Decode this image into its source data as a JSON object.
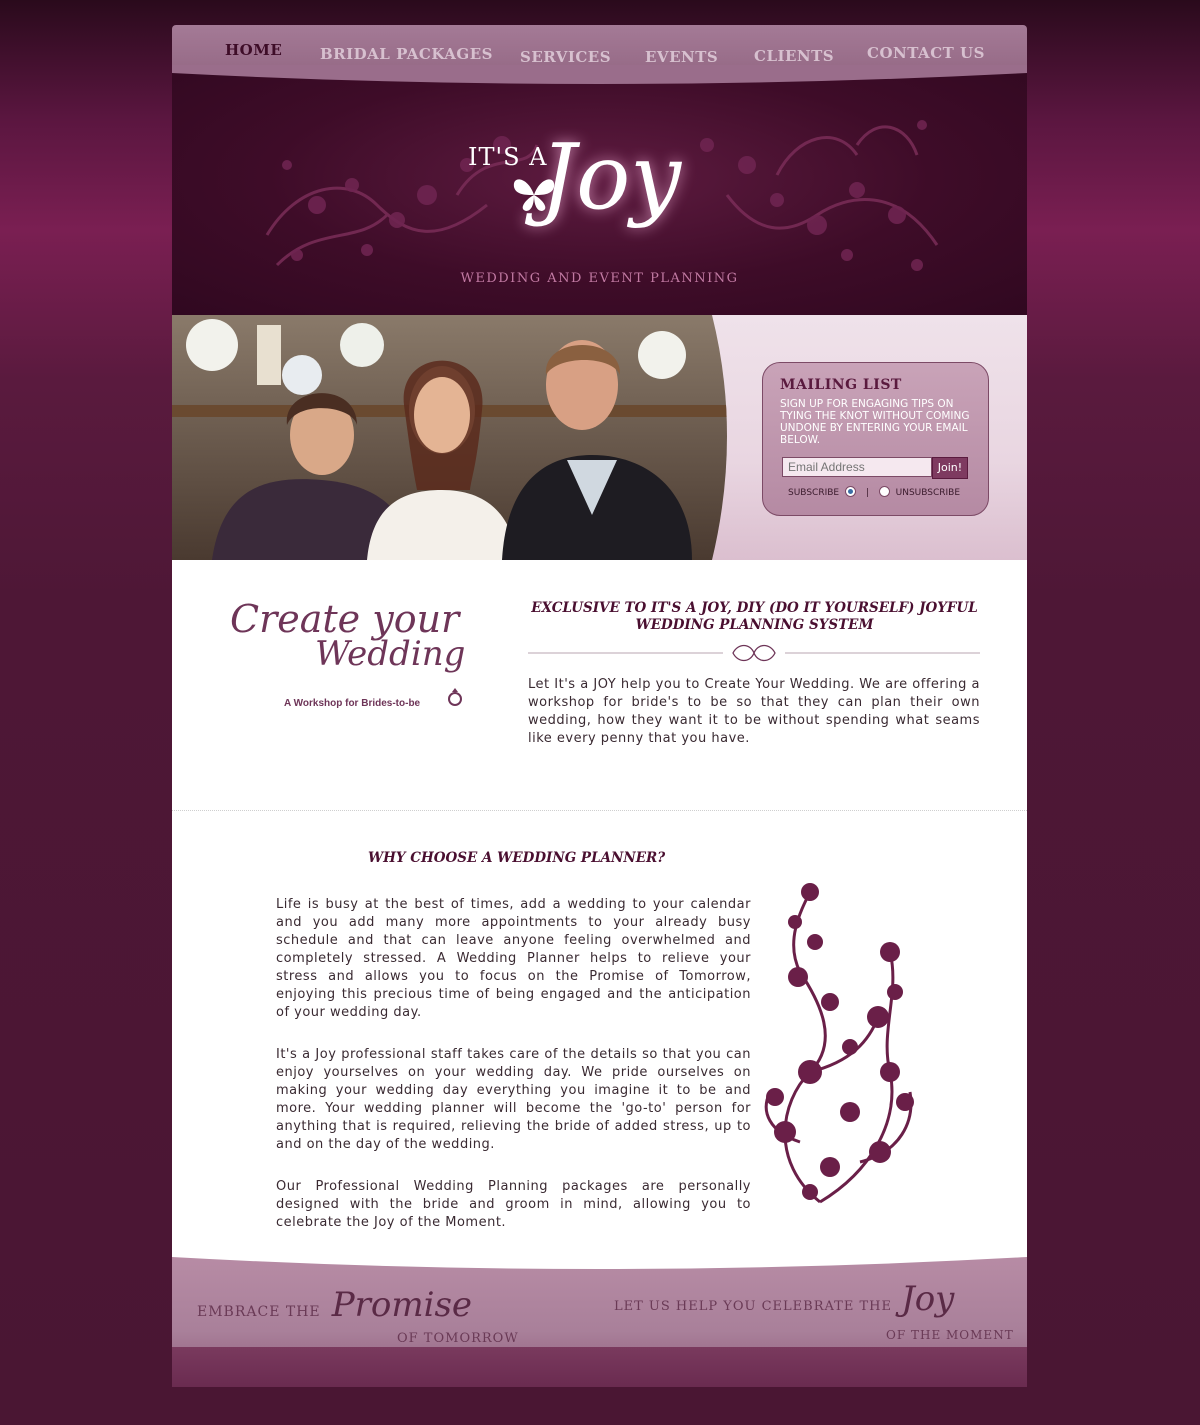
{
  "nav": {
    "items": [
      "HOME",
      "BRIDAL PACKAGES",
      "SERVICES",
      "EVENTS",
      "CLIENTS",
      "CONTACT US"
    ]
  },
  "header": {
    "logo_prefix": "IT'S A",
    "logo_script": "Joy",
    "tagline": "WEDDING AND EVENT PLANNING"
  },
  "mailing_list": {
    "title": "MAILING LIST",
    "description": "SIGN UP FOR ENGAGING TIPS ON TYING THE KNOT WITHOUT COMING UNDONE BY ENTERING YOUR EMAIL BELOW.",
    "email_placeholder": "Email Address",
    "join_label": "Join!",
    "subscribe_label": "SUBSCRIBE",
    "separator": "|",
    "unsubscribe_label": "UNSUBSCRIBE"
  },
  "workshop": {
    "script_line1": "Create your",
    "script_line2": "Wedding",
    "subtitle": "A Workshop for Brides-to-be"
  },
  "exclusive": {
    "title": "EXCLUSIVE TO IT'S A JOY, DIY (DO IT YOURSELF) JOYFUL WEDDING PLANNING SYSTEM",
    "text": "Let It's a JOY help you to Create Your Wedding. We are offering a workshop for bride's to be so that they can plan their own wedding, how they want it to be without spending what seams like every penny that you have."
  },
  "why": {
    "title": "WHY CHOOSE A WEDDING PLANNER?",
    "paragraphs": [
      "Life is busy at the best of times, add a wedding to your calendar and you add many more appointments to your already busy schedule and that can leave anyone feeling overwhelmed and completely stressed. A Wedding Planner helps to relieve your stress and allows you to focus on the Promise of Tomorrow, enjoying this precious time of being engaged and the anticipation of your wedding day.",
      "It's a Joy professional staff takes care of the details so that you can enjoy yourselves on your wedding day. We pride ourselves on making your wedding day everything you imagine it to be and more. Your wedding planner will become the 'go-to' person for anything that is required, relieving the bride of added stress, up to and on the day of the wedding.",
      "Our Professional Wedding Planning packages are personally designed with the bride and groom in mind, allowing you to celebrate the Joy of the Moment."
    ]
  },
  "footer": {
    "left_small": "EMBRACE THE",
    "left_script": "Promise",
    "left_tail": "OF TOMORROW",
    "right_small": "LET US HELP YOU CELEBRATE THE",
    "right_script": "Joy",
    "right_tail": "OF THE MOMENT"
  },
  "colors": {
    "accent": "#4a0f30",
    "nav_bg": "#a47a96",
    "header_bg": "#3e0c28"
  }
}
